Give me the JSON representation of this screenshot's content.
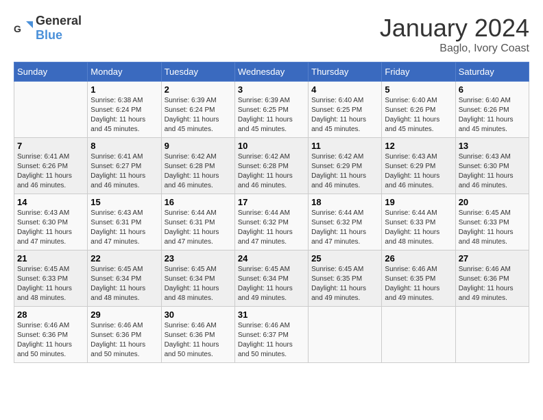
{
  "header": {
    "logo_general": "General",
    "logo_blue": "Blue",
    "month": "January 2024",
    "location": "Baglo, Ivory Coast"
  },
  "days_of_week": [
    "Sunday",
    "Monday",
    "Tuesday",
    "Wednesday",
    "Thursday",
    "Friday",
    "Saturday"
  ],
  "weeks": [
    [
      {
        "day": "",
        "info": ""
      },
      {
        "day": "1",
        "info": "Sunrise: 6:38 AM\nSunset: 6:24 PM\nDaylight: 11 hours and 45 minutes."
      },
      {
        "day": "2",
        "info": "Sunrise: 6:39 AM\nSunset: 6:24 PM\nDaylight: 11 hours and 45 minutes."
      },
      {
        "day": "3",
        "info": "Sunrise: 6:39 AM\nSunset: 6:25 PM\nDaylight: 11 hours and 45 minutes."
      },
      {
        "day": "4",
        "info": "Sunrise: 6:40 AM\nSunset: 6:25 PM\nDaylight: 11 hours and 45 minutes."
      },
      {
        "day": "5",
        "info": "Sunrise: 6:40 AM\nSunset: 6:26 PM\nDaylight: 11 hours and 45 minutes."
      },
      {
        "day": "6",
        "info": "Sunrise: 6:40 AM\nSunset: 6:26 PM\nDaylight: 11 hours and 45 minutes."
      }
    ],
    [
      {
        "day": "7",
        "info": "Sunrise: 6:41 AM\nSunset: 6:26 PM\nDaylight: 11 hours and 46 minutes."
      },
      {
        "day": "8",
        "info": "Sunrise: 6:41 AM\nSunset: 6:27 PM\nDaylight: 11 hours and 46 minutes."
      },
      {
        "day": "9",
        "info": "Sunrise: 6:42 AM\nSunset: 6:28 PM\nDaylight: 11 hours and 46 minutes."
      },
      {
        "day": "10",
        "info": "Sunrise: 6:42 AM\nSunset: 6:28 PM\nDaylight: 11 hours and 46 minutes."
      },
      {
        "day": "11",
        "info": "Sunrise: 6:42 AM\nSunset: 6:29 PM\nDaylight: 11 hours and 46 minutes."
      },
      {
        "day": "12",
        "info": "Sunrise: 6:43 AM\nSunset: 6:29 PM\nDaylight: 11 hours and 46 minutes."
      },
      {
        "day": "13",
        "info": "Sunrise: 6:43 AM\nSunset: 6:30 PM\nDaylight: 11 hours and 46 minutes."
      }
    ],
    [
      {
        "day": "14",
        "info": "Sunrise: 6:43 AM\nSunset: 6:30 PM\nDaylight: 11 hours and 47 minutes."
      },
      {
        "day": "15",
        "info": "Sunrise: 6:43 AM\nSunset: 6:31 PM\nDaylight: 11 hours and 47 minutes."
      },
      {
        "day": "16",
        "info": "Sunrise: 6:44 AM\nSunset: 6:31 PM\nDaylight: 11 hours and 47 minutes."
      },
      {
        "day": "17",
        "info": "Sunrise: 6:44 AM\nSunset: 6:32 PM\nDaylight: 11 hours and 47 minutes."
      },
      {
        "day": "18",
        "info": "Sunrise: 6:44 AM\nSunset: 6:32 PM\nDaylight: 11 hours and 47 minutes."
      },
      {
        "day": "19",
        "info": "Sunrise: 6:44 AM\nSunset: 6:33 PM\nDaylight: 11 hours and 48 minutes."
      },
      {
        "day": "20",
        "info": "Sunrise: 6:45 AM\nSunset: 6:33 PM\nDaylight: 11 hours and 48 minutes."
      }
    ],
    [
      {
        "day": "21",
        "info": "Sunrise: 6:45 AM\nSunset: 6:33 PM\nDaylight: 11 hours and 48 minutes."
      },
      {
        "day": "22",
        "info": "Sunrise: 6:45 AM\nSunset: 6:34 PM\nDaylight: 11 hours and 48 minutes."
      },
      {
        "day": "23",
        "info": "Sunrise: 6:45 AM\nSunset: 6:34 PM\nDaylight: 11 hours and 48 minutes."
      },
      {
        "day": "24",
        "info": "Sunrise: 6:45 AM\nSunset: 6:34 PM\nDaylight: 11 hours and 49 minutes."
      },
      {
        "day": "25",
        "info": "Sunrise: 6:45 AM\nSunset: 6:35 PM\nDaylight: 11 hours and 49 minutes."
      },
      {
        "day": "26",
        "info": "Sunrise: 6:46 AM\nSunset: 6:35 PM\nDaylight: 11 hours and 49 minutes."
      },
      {
        "day": "27",
        "info": "Sunrise: 6:46 AM\nSunset: 6:36 PM\nDaylight: 11 hours and 49 minutes."
      }
    ],
    [
      {
        "day": "28",
        "info": "Sunrise: 6:46 AM\nSunset: 6:36 PM\nDaylight: 11 hours and 50 minutes."
      },
      {
        "day": "29",
        "info": "Sunrise: 6:46 AM\nSunset: 6:36 PM\nDaylight: 11 hours and 50 minutes."
      },
      {
        "day": "30",
        "info": "Sunrise: 6:46 AM\nSunset: 6:36 PM\nDaylight: 11 hours and 50 minutes."
      },
      {
        "day": "31",
        "info": "Sunrise: 6:46 AM\nSunset: 6:37 PM\nDaylight: 11 hours and 50 minutes."
      },
      {
        "day": "",
        "info": ""
      },
      {
        "day": "",
        "info": ""
      },
      {
        "day": "",
        "info": ""
      }
    ]
  ]
}
